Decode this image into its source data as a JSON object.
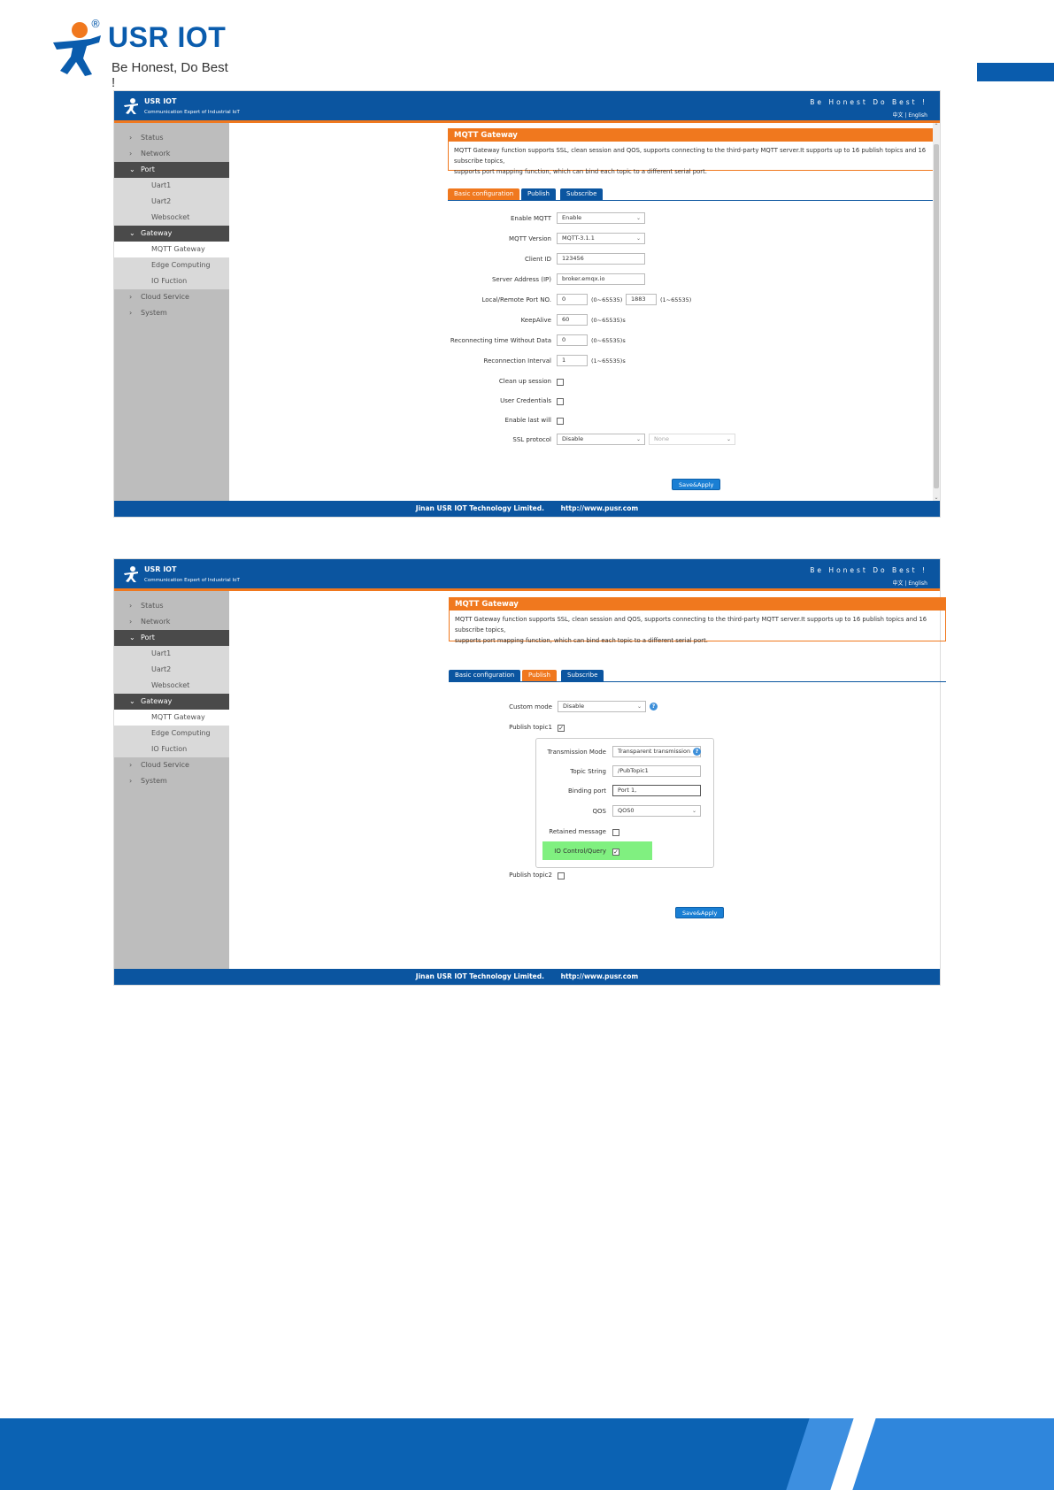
{
  "doc": {
    "brand": "USR IOT",
    "registered": "®",
    "slogan": "Be Honest, Do Best !"
  },
  "app": {
    "title": "USR IOT",
    "subtitle": "Communication Expert of Industrial IoT",
    "motto": "Be Honest Do Best !",
    "lang": "中文 | English",
    "footer_company": "Jinan USR IOT Technology Limited.",
    "footer_url": "http://www.pusr.com"
  },
  "sidebar": {
    "status": "Status",
    "network": "Network",
    "port": "Port",
    "uart1": "Uart1",
    "uart2": "Uart2",
    "websocket": "Websocket",
    "gateway": "Gateway",
    "mqtt_gateway": "MQTT Gateway",
    "edge_computing": "Edge Computing",
    "io_fuction": "IO Fuction",
    "cloud_service": "Cloud Service",
    "system": "System"
  },
  "panel": {
    "title": "MQTT Gateway",
    "desc1": "MQTT Gateway function supports SSL, clean session and QOS, supports connecting to the third-party MQTT server.It supports up to 16 publish topics and 16 subscribe topics,",
    "desc2": "supports port mapping function, which can bind each topic to a different serial port."
  },
  "tabs": {
    "basic": "Basic configuration",
    "publish": "Publish",
    "subscribe": "Subscribe"
  },
  "basic": {
    "enable_mqtt_label": "Enable MQTT",
    "enable_mqtt_value": "Enable",
    "mqtt_version_label": "MQTT Version",
    "mqtt_version_value": "MQTT-3.1.1",
    "client_id_label": "Client ID",
    "client_id_value": "123456",
    "server_label": "Server Address (IP)",
    "server_value": "broker.emqx.io",
    "port_label": "Local/Remote Port NO.",
    "local_port_value": "0",
    "local_port_hint": "(0~65535)",
    "remote_port_value": "1883",
    "remote_port_hint": "(1~65535)",
    "keepalive_label": "KeepAlive",
    "keepalive_value": "60",
    "keepalive_hint": "(0~65535)s",
    "reconn_nodata_label": "Reconnecting time Without Data",
    "reconn_nodata_value": "0",
    "reconn_nodata_hint": "(0~65535)s",
    "reconn_interval_label": "Reconnection Interval",
    "reconn_interval_value": "1",
    "reconn_interval_hint": "(1~65535)s",
    "clean_session_label": "Clean up session",
    "user_cred_label": "User Credentials",
    "last_will_label": "Enable last will",
    "ssl_label": "SSL protocol",
    "ssl_value": "Disable",
    "ssl_cert_value": "None",
    "save": "Save&Apply"
  },
  "publish": {
    "custom_mode_label": "Custom mode",
    "custom_mode_value": "Disable",
    "topic1_label": "Publish topic1",
    "topic1_checked": "✓",
    "trans_mode_label": "Transmission Mode",
    "trans_mode_value": "Transparent transmission",
    "topic_string_label": "Topic String",
    "topic_string_value": "/PubTopic1",
    "binding_port_label": "Binding port",
    "binding_port_value": "Port 1,",
    "qos_label": "QOS",
    "qos_value": "QOS0",
    "retained_label": "Retained message",
    "io_control_label": "IO Control/Query",
    "io_control_checked": "✓",
    "topic2_label": "Publish topic2",
    "save": "Save&Apply"
  },
  "colors": {
    "header_blue": "#0b55a0",
    "accent_orange": "#f0781e",
    "highlight_green": "#80f080"
  }
}
